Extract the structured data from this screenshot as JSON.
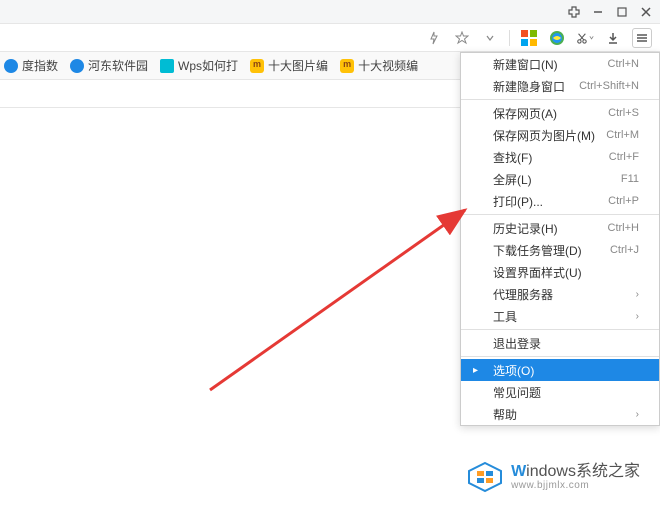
{
  "bookmarks": [
    {
      "label": "度指数",
      "icon": "blue"
    },
    {
      "label": "河东软件园",
      "icon": "blue"
    },
    {
      "label": "Wps如何打",
      "icon": "cyan"
    },
    {
      "label": "十大图片编",
      "icon": "yellow"
    },
    {
      "label": "十大视频编",
      "icon": "yellow"
    }
  ],
  "menu": {
    "sections": [
      [
        {
          "label": "新建窗口(N)",
          "shortcut": "Ctrl+N"
        },
        {
          "label": "新建隐身窗口",
          "shortcut": "Ctrl+Shift+N"
        }
      ],
      [
        {
          "label": "保存网页(A)",
          "shortcut": "Ctrl+S"
        },
        {
          "label": "保存网页为图片(M)",
          "shortcut": "Ctrl+M"
        },
        {
          "label": "查找(F)",
          "shortcut": "Ctrl+F"
        },
        {
          "label": "全屏(L)",
          "shortcut": "F11"
        },
        {
          "label": "打印(P)...",
          "shortcut": "Ctrl+P"
        }
      ],
      [
        {
          "label": "历史记录(H)",
          "shortcut": "Ctrl+H"
        },
        {
          "label": "下载任务管理(D)",
          "shortcut": "Ctrl+J"
        },
        {
          "label": "设置界面样式(U)",
          "shortcut": ""
        },
        {
          "label": "代理服务器",
          "shortcut": "",
          "submenu": true
        },
        {
          "label": "工具",
          "shortcut": "",
          "submenu": true
        }
      ],
      [
        {
          "label": "退出登录",
          "shortcut": ""
        }
      ],
      [
        {
          "label": "选项(O)",
          "shortcut": "",
          "highlighted": true
        },
        {
          "label": "常见问题",
          "shortcut": ""
        },
        {
          "label": "帮助",
          "shortcut": "",
          "submenu": true
        }
      ]
    ]
  },
  "watermark": {
    "title_part1": "indows",
    "title_part2": "系统之家",
    "url": "www.bjjmlx.com"
  }
}
